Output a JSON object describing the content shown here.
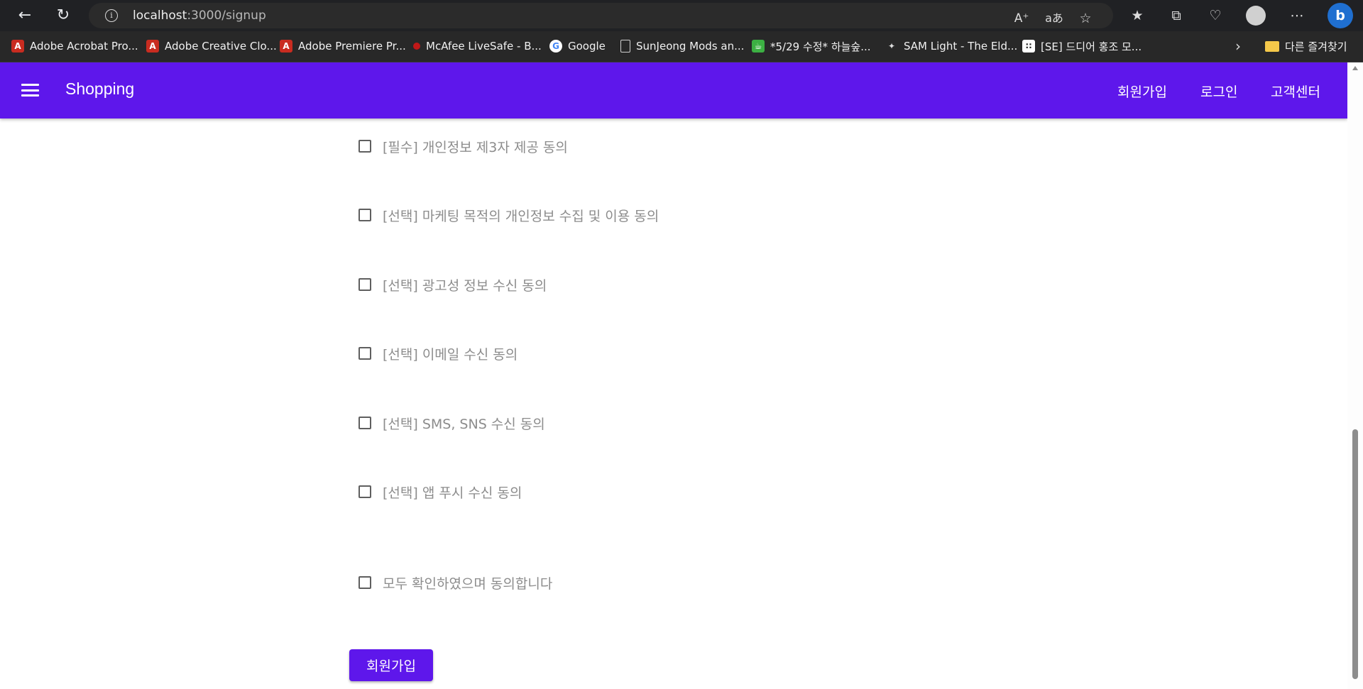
{
  "browser": {
    "url_host": "localhost",
    "url_path": ":3000/signup",
    "bookmarks": [
      {
        "label": "Adobe Acrobat Pro...",
        "icon": "adobe-icon"
      },
      {
        "label": "Adobe Creative Clo...",
        "icon": "adobe-icon"
      },
      {
        "label": "Adobe Premiere Pr...",
        "icon": "adobe-icon"
      },
      {
        "label": "McAfee LiveSafe - B...",
        "icon": "mcafee-icon"
      },
      {
        "label": "Google",
        "icon": "google-icon"
      },
      {
        "label": "SunJeong Mods an...",
        "icon": "document-icon"
      },
      {
        "label": "*5/29 수정* 하늘숲...",
        "icon": "green-cup-icon"
      },
      {
        "label": "SAM Light - The Eld...",
        "icon": "sam-icon"
      },
      {
        "label": "[SE] 드디어 홍조 모...",
        "icon": "se-icon"
      }
    ],
    "other_favorites": "다른 즐겨찾기"
  },
  "app_bar": {
    "title": "Shopping",
    "nav": [
      "회원가입",
      "로그인",
      "고객센터"
    ]
  },
  "agreements": [
    {
      "label": "[필수] 개인정보 제3자 제공 동의",
      "checked": false
    },
    {
      "label": "[선택] 마케팅 목적의 개인정보 수집 및 이용 동의",
      "checked": false
    },
    {
      "label": "[선택] 광고성 정보 수신 동의",
      "checked": false
    },
    {
      "label": "[선택] 이메일 수신 동의",
      "checked": false
    },
    {
      "label": "[선택] SMS, SNS 수신 동의",
      "checked": false
    },
    {
      "label": "[선택] 앱 푸시 수신 동의",
      "checked": false
    }
  ],
  "agree_all": {
    "label": "모두 확인하였으며 동의합니다",
    "checked": false
  },
  "signup_button": "회원가입",
  "colors": {
    "accent": "#5e17eb",
    "label": "#8c8c8c"
  }
}
